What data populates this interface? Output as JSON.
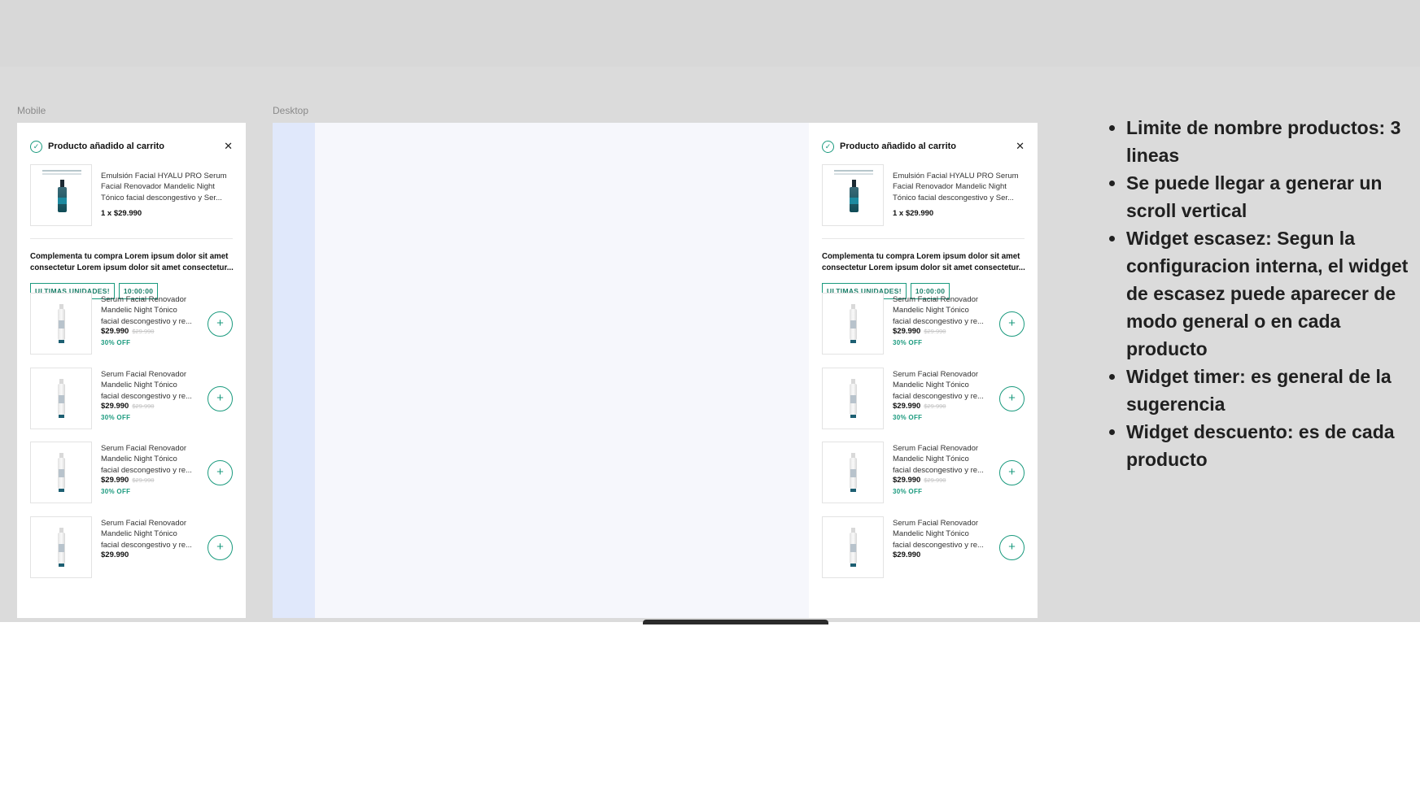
{
  "frames": {
    "mobile_label": "Mobile",
    "desktop_label": "Desktop"
  },
  "panel": {
    "title": "Producto añadido al carrito",
    "close_glyph": "✕",
    "check_glyph": "✓",
    "added": {
      "name_l1": "Emulsión Facial HYALU PRO Serum",
      "name_l2": "Facial Renovador Mandelic Night",
      "name_l3": "Tónico facial descongestivo y Ser...",
      "price": "1 x $29.990"
    },
    "complement": {
      "line1": "Complementa tu compra Lorem ipsum dolor sit amet",
      "line2": "consectetur Lorem ipsum dolor sit amet consectetur..."
    },
    "badges": {
      "scarcity": "ULTIMAS UNIDADES!",
      "timer": "10:00:00"
    },
    "products": [
      {
        "l1": "Serum Facial Renovador",
        "l2": "Mandelic Night Tónico",
        "l3": "facial descongestivo y re...",
        "price": "$29.990",
        "old": "$29.990",
        "off": "30% OFF"
      },
      {
        "l1": "Serum Facial Renovador",
        "l2": "Mandelic Night Tónico",
        "l3": "facial descongestivo y re...",
        "price": "$29.990",
        "old": "$29.990",
        "off": "30% OFF"
      },
      {
        "l1": "Serum Facial Renovador",
        "l2": "Mandelic Night Tónico",
        "l3": "facial descongestivo y re...",
        "price": "$29.990",
        "old": "$29.990",
        "off": "30% OFF"
      },
      {
        "l1": "Serum Facial Renovador",
        "l2": "Mandelic Night Tónico",
        "l3": "facial descongestivo y re...",
        "price": "$29.990"
      }
    ],
    "add_glyph": "+"
  },
  "notes": [
    "Limite de nombre productos: 3 lineas",
    "Se puede llegar a generar un scroll vertical",
    "Widget escasez: Segun la configuracion interna, el widget de escasez puede aparecer de modo general o en cada producto",
    "Widget timer: es general de la sugerencia",
    "Widget descuento: es de cada producto"
  ],
  "colors": {
    "accent": "#1a9a7e",
    "canvas": "#dbdbdb",
    "desktop_sidebar": "#e0e8fb",
    "desktop_bg": "#f6f7fc"
  },
  "icons": [
    "check-circle-icon",
    "close-icon",
    "plus-icon",
    "product-bottle-icon"
  ]
}
